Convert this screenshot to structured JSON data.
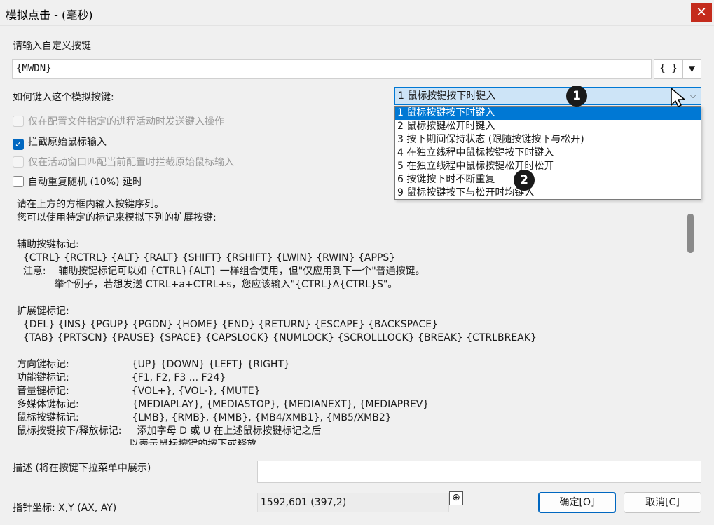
{
  "window": {
    "title": "模拟点击 - (毫秒)",
    "close_glyph": "✕"
  },
  "custom_key": {
    "label": "请输入自定义按键",
    "value": "{MWDN}",
    "brace_button": "{ }",
    "brace_dropdown_glyph": "▼"
  },
  "mode": {
    "label": "如何键入这个模拟按键:",
    "selected": "1 鼠标按键按下时键入",
    "arrow_glyph": "⌵",
    "options": [
      "1 鼠标按键按下时键入",
      "2 鼠标按键松开时键入",
      "3 按下期间保持状态 (跟随按键按下与松开)",
      "4 在独立线程中鼠标按键按下时键入",
      "5 在独立线程中鼠标按键松开时松开",
      "6 按键按下时不断重复",
      "9 鼠标按键按下与松开时均键入"
    ]
  },
  "checkboxes": [
    {
      "label": "仅在配置文件指定的进程活动时发送键入操作",
      "checked": false,
      "enabled": false
    },
    {
      "label": "拦截原始鼠标输入",
      "checked": true,
      "enabled": true
    },
    {
      "label": "仅在活动窗口匹配当前配置时拦截原始鼠标输入",
      "checked": false,
      "enabled": false
    },
    {
      "label": "自动重复随机 (10%) 延时",
      "checked": false,
      "enabled": true
    }
  ],
  "help_text": "请在上方的方框内输入按键序列。\n您可以使用特定的标记来模拟下列的扩展按键:\n\n辅助按键标记:\n  {CTRL} {RCTRL} {ALT} {RALT} {SHIFT} {RSHIFT} {LWIN} {RWIN} {APPS}\n  注意:    辅助按键标记可以如 {CTRL}{ALT} 一样组合使用，但\"仅应用到下一个\"普通按键。\n            举个例子，若想发送 CTRL+a+CTRL+s，您应该输入\"{CTRL}A{CTRL}S\"。\n\n扩展键标记:\n  {DEL} {INS} {PGUP} {PGDN} {HOME} {END} {RETURN} {ESCAPE} {BACKSPACE}\n  {TAB} {PRTSCN} {PAUSE} {SPACE} {CAPSLOCK} {NUMLOCK} {SCROLLLOCK} {BREAK} {CTRLBREAK}\n\n方向键标记:                    {UP} {DOWN} {LEFT} {RIGHT}\n功能键标记:                    {F1, F2, F3 ... F24}\n音量键标记:                    {VOL+}, {VOL-}, {MUTE}\n多媒体键标记:                 {MEDIAPLAY}, {MEDIASTOP}, {MEDIANEXT}, {MEDIAPREV}\n鼠标按键标记:                 {LMB}, {RMB}, {MMB}, {MB4/XMB1}, {MB5/XMB2}\n鼠标按键按下/释放标记:     添加字母 D 或 U 在上述鼠标按键标记之后\n                                    以表示鼠标按键的按下或释放",
  "description": {
    "label": "描述 (将在按键下拉菜单中展示)",
    "value": ""
  },
  "pointer": {
    "label": "指针坐标: X,Y (AX, AY)",
    "value": "1592,601 (397,2)",
    "picker_glyph": "⊕"
  },
  "buttons": {
    "ok": "确定[O]",
    "cancel": "取消[C]"
  },
  "badges": [
    "1",
    "2"
  ]
}
